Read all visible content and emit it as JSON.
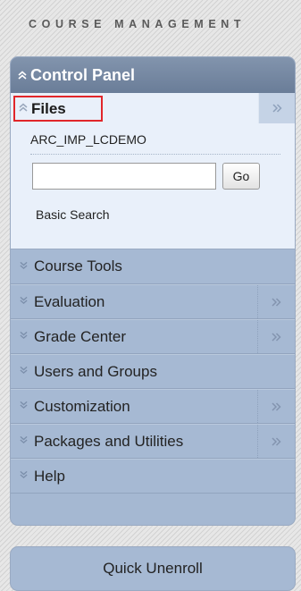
{
  "section_title": "COURSE MANAGEMENT",
  "control_panel": {
    "title": "Control Panel",
    "files": {
      "title": "Files",
      "folder_name": "ARC_IMP_LCDEMO",
      "search_value": "",
      "go_label": "Go",
      "basic_search_label": "Basic Search"
    },
    "items": [
      {
        "label": "Course Tools",
        "has_expand": false
      },
      {
        "label": "Evaluation",
        "has_expand": true
      },
      {
        "label": "Grade Center",
        "has_expand": true
      },
      {
        "label": "Users and Groups",
        "has_expand": false
      },
      {
        "label": "Customization",
        "has_expand": true
      },
      {
        "label": "Packages and Utilities",
        "has_expand": true
      },
      {
        "label": "Help",
        "has_expand": false
      }
    ]
  },
  "quick_unenroll_label": "Quick Unenroll",
  "icons": {
    "collapse": "double-chevron-up-icon",
    "expand": "double-chevron-down-icon",
    "flyout": "double-chevron-right-icon"
  },
  "colors": {
    "header_bg": "#7587a1",
    "nav_bg": "#a6b9d3",
    "files_bg": "#e9f0fa",
    "highlight_border": "#e1262a"
  }
}
